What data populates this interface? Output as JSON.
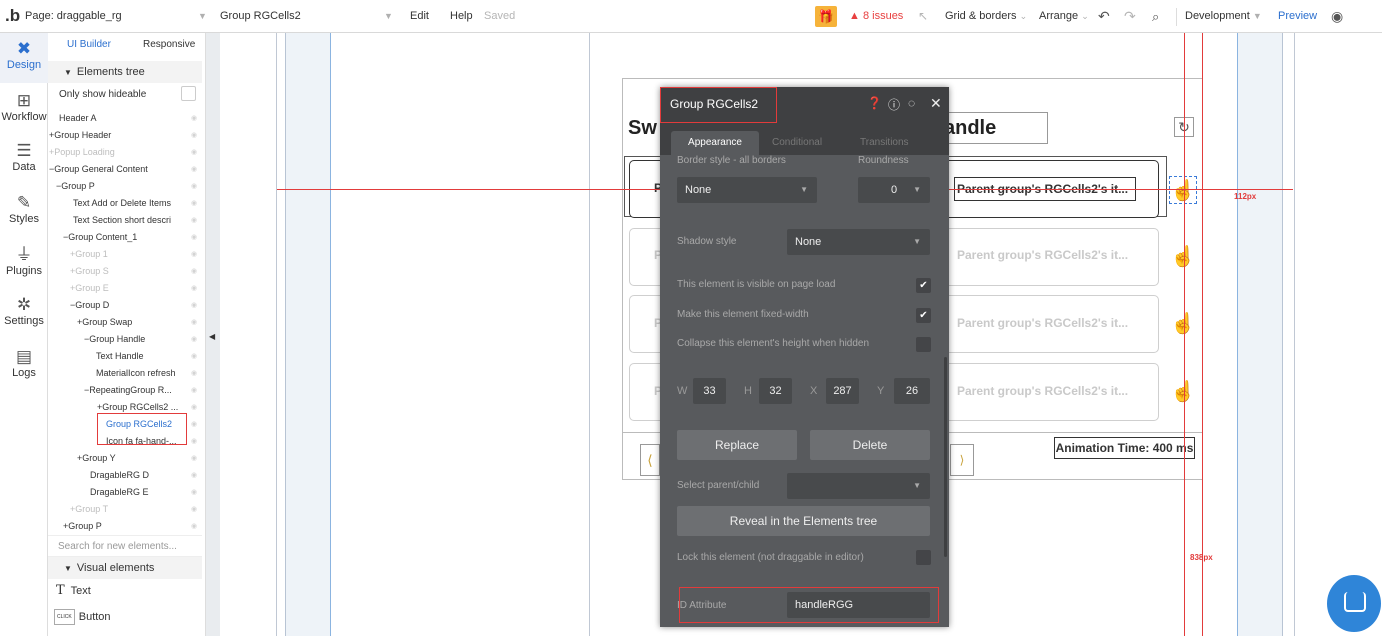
{
  "topbar": {
    "page_selector": "Page: draggable_rg",
    "element_selector": "Group RGCells2",
    "edit": "Edit",
    "help": "Help",
    "saved": "Saved",
    "issues": "8 issues",
    "grid_borders": "Grid & borders",
    "arrange": "Arrange",
    "development": "Development",
    "preview": "Preview"
  },
  "left_nav": [
    {
      "label": "Design",
      "icon": "design-icon"
    },
    {
      "label": "Workflow",
      "icon": "workflow-icon"
    },
    {
      "label": "Data",
      "icon": "data-icon"
    },
    {
      "label": "Styles",
      "icon": "styles-icon"
    },
    {
      "label": "Plugins",
      "icon": "plugins-icon"
    },
    {
      "label": "Settings",
      "icon": "settings-icon"
    },
    {
      "label": "Logs",
      "icon": "logs-icon"
    }
  ],
  "panel": {
    "tab_ui_builder": "UI Builder",
    "tab_responsive": "Responsive",
    "elements_tree": "Elements tree",
    "only_show_hideable": "Only show hideable",
    "search_placeholder": "Search for new elements...",
    "visual_elements": "Visual elements",
    "visual_items": [
      "Text",
      "Button"
    ]
  },
  "tree": [
    {
      "label": "Header A",
      "muted": false
    },
    {
      "label": "+Group Header",
      "muted": false
    },
    {
      "label": "+Popup Loading",
      "muted": true
    },
    {
      "label": "−Group General Content",
      "muted": false
    },
    {
      "label": "−Group P",
      "muted": false
    },
    {
      "label": "Text Add or Delete Items",
      "muted": false
    },
    {
      "label": "Text Section short descri",
      "muted": false
    },
    {
      "label": "−Group Content_1",
      "muted": false
    },
    {
      "label": "+Group 1",
      "muted": true
    },
    {
      "label": "+Group S",
      "muted": true
    },
    {
      "label": "+Group E",
      "muted": true
    },
    {
      "label": "−Group D",
      "muted": false
    },
    {
      "label": "+Group Swap",
      "muted": false
    },
    {
      "label": "−Group Handle",
      "muted": false
    },
    {
      "label": "Text Handle",
      "muted": false
    },
    {
      "label": "MaterialIcon refresh",
      "muted": false
    },
    {
      "label": "−RepeatingGroup R...",
      "muted": false
    },
    {
      "label": "+Group RGCells2 ...",
      "muted": false
    },
    {
      "label": "Group RGCells2",
      "muted": false
    },
    {
      "label": "Icon fa fa-hand-...",
      "muted": false
    },
    {
      "label": "+Group Y",
      "muted": false
    },
    {
      "label": "DragableRG D",
      "muted": false
    },
    {
      "label": "DragableRG E",
      "muted": false
    },
    {
      "label": "+Group T",
      "muted": true
    },
    {
      "label": "+Group P",
      "muted": false
    }
  ],
  "canvas": {
    "title_left": "Sw",
    "title_right": "andle",
    "cell_text": "Parent group's RGCells2's it...",
    "animation_time": "Animation Time: 400 ms",
    "guide_112": "112px",
    "guide_838": "838px",
    "cell_letter": "P"
  },
  "editor": {
    "title": "Group RGCells2",
    "tabs": [
      "Appearance",
      "Conditional",
      "Transitions"
    ],
    "border_style_label": "Border style - all borders",
    "roundness_label": "Roundness",
    "border_style_value": "None",
    "roundness_value": "0",
    "shadow_style_label": "Shadow style",
    "shadow_style_value": "None",
    "visible_on_load": "This element is visible on page load",
    "visible_on_load_checked": true,
    "fixed_width": "Make this element fixed-width",
    "fixed_width_checked": true,
    "collapse_height": "Collapse this element's height when hidden",
    "collapse_height_checked": false,
    "w_label": "W",
    "w": "33",
    "h_label": "H",
    "h": "32",
    "x_label": "X",
    "x": "287",
    "y_label": "Y",
    "y": "26",
    "replace": "Replace",
    "delete": "Delete",
    "select_parent_child": "Select parent/child",
    "reveal": "Reveal in the Elements tree",
    "lock": "Lock this element (not draggable in editor)",
    "id_attribute_label": "ID Attribute",
    "id_attribute_value": "handleRGG"
  },
  "colors": {
    "accent": "#2b6fce",
    "guide_red": "#e23b3b",
    "editor_bg": "#585a5d",
    "help_bubble": "#2f85d8"
  }
}
